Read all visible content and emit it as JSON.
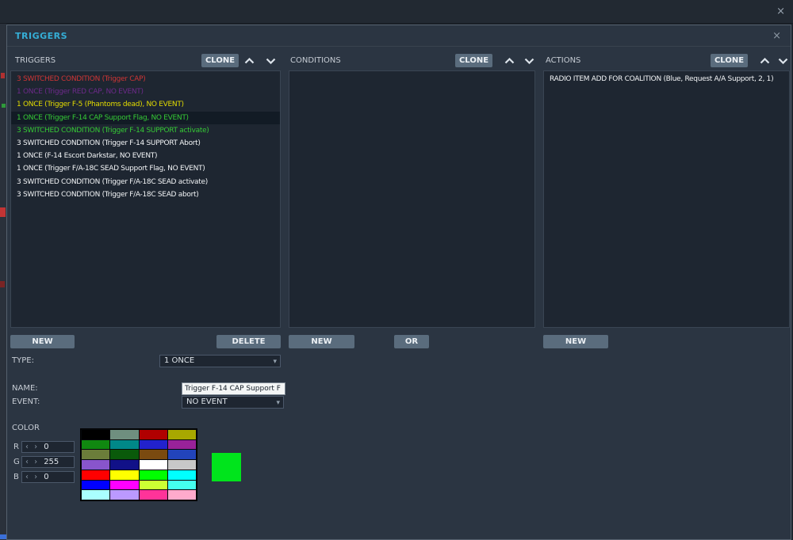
{
  "window": {
    "close_label": "×"
  },
  "dialog": {
    "title": "TRIGGERS",
    "close_label": "×"
  },
  "colors": {
    "accent": "#35aed6",
    "selected_row_bg": "#121b25"
  },
  "icons": {
    "dropdown_arrow": "▾",
    "stepper_arrows": "‹ ›"
  },
  "panels": {
    "triggers": {
      "header": "TRIGGERS",
      "clone_label": "CLONE",
      "new_label": "NEW",
      "delete_label": "DELETE",
      "items": [
        {
          "text": "3 SWITCHED CONDITION (Trigger CAP)",
          "color": "#cf3535",
          "selected": false
        },
        {
          "text": "1 ONCE (Trigger RED CAP, NO EVENT)",
          "color": "#6d2a8a",
          "selected": false
        },
        {
          "text": "1 ONCE (Trigger F-5 (Phantoms dead), NO EVENT)",
          "color": "#e3dc00",
          "selected": false
        },
        {
          "text": "1 ONCE (Trigger F-14 CAP Support Flag, NO EVENT)",
          "color": "#35c935",
          "selected": true
        },
        {
          "text": "3 SWITCHED CONDITION (Trigger F-14 SUPPORT activate)",
          "color": "#35c935",
          "selected": false
        },
        {
          "text": "3 SWITCHED CONDITION (Trigger F-14 SUPPORT Abort)",
          "color": "#f2f4f6",
          "selected": false
        },
        {
          "text": "1 ONCE (F-14 Escort Darkstar, NO EVENT)",
          "color": "#f2f4f6",
          "selected": false
        },
        {
          "text": "1 ONCE (Trigger F/A-18C SEAD Support Flag, NO EVENT)",
          "color": "#f2f4f6",
          "selected": false
        },
        {
          "text": "3 SWITCHED CONDITION (Trigger F/A-18C SEAD activate)",
          "color": "#f2f4f6",
          "selected": false
        },
        {
          "text": "3 SWITCHED CONDITION (Trigger F/A-18C SEAD abort)",
          "color": "#f2f4f6",
          "selected": false
        }
      ]
    },
    "conditions": {
      "header": "CONDITIONS",
      "clone_label": "CLONE",
      "new_label": "NEW",
      "or_label": "OR",
      "items": []
    },
    "actions": {
      "header": "ACTIONS",
      "clone_label": "CLONE",
      "new_label": "NEW",
      "items": [
        {
          "text": "RADIO ITEM ADD FOR COALITION (Blue, Request A/A Support, 2, 1)",
          "color": "#f2f4f6",
          "selected": false
        }
      ]
    }
  },
  "form": {
    "type_label": "TYPE:",
    "type_value": "1 ONCE",
    "name_label": "NAME:",
    "name_value": "Trigger F-14 CAP Support F",
    "event_label": "EVENT:",
    "event_value": "NO EVENT",
    "color_label": "COLOR",
    "r_label": "R",
    "g_label": "G",
    "b_label": "B",
    "r_value": "0",
    "g_value": "255",
    "b_value": "0",
    "preview_color": "#00e importantly"
  }
}
